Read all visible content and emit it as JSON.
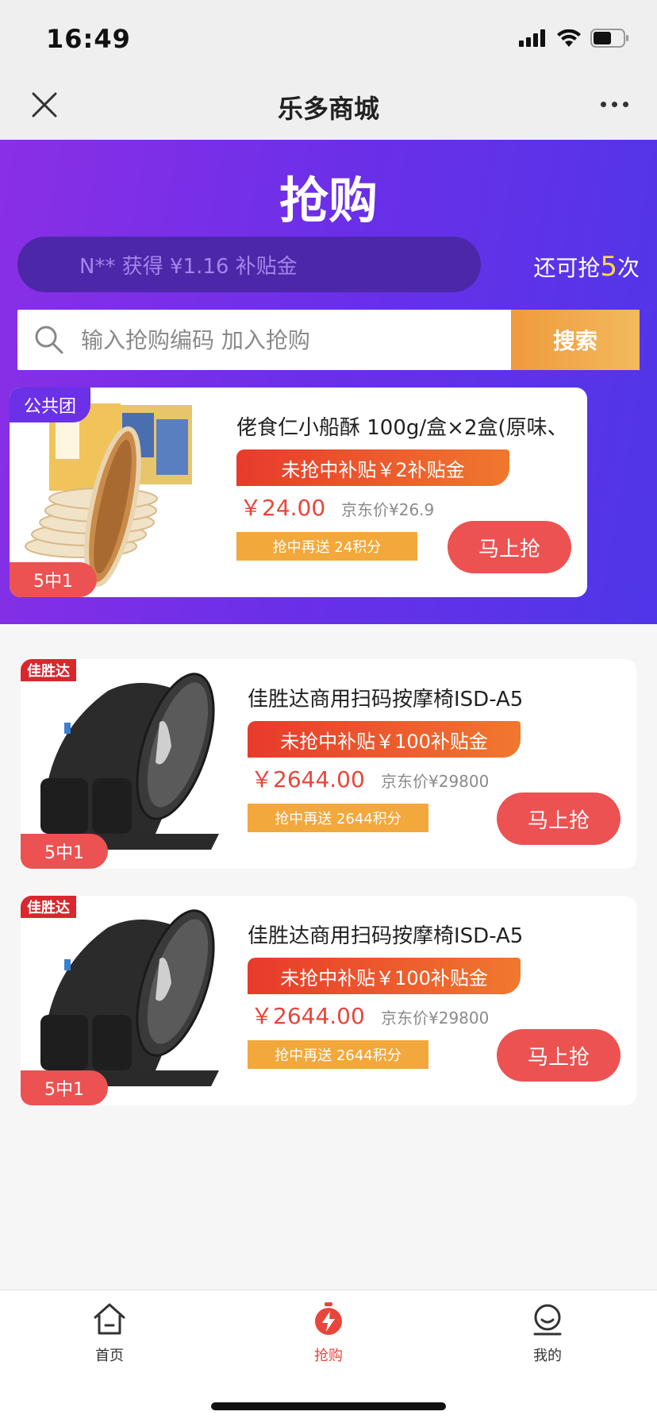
{
  "status": {
    "time": "16:49"
  },
  "nav": {
    "title": "乐多商城"
  },
  "hero": {
    "title": "抢购",
    "ticker": "N** 获得 ¥1.16 补贴金",
    "remain_prefix": "还可抢",
    "remain_count": "5",
    "remain_suffix": "次"
  },
  "search": {
    "placeholder": "输入抢购编码 加入抢购",
    "button": "搜索"
  },
  "products": [
    {
      "badge": "公共团",
      "odds": "5中1",
      "title": "佬食仁小船酥 100g/盒×2盒(原味、",
      "subsidy": "未抢中补贴￥2补贴金",
      "price": "￥24.00",
      "ref_price": "京东价¥26.9",
      "points": "抢中再送 24积分",
      "buy": "马上抢"
    },
    {
      "brand": "佳胜达",
      "odds": "5中1",
      "title": "佳胜达商用扫码按摩椅ISD-A5",
      "subsidy": "未抢中补贴￥100补贴金",
      "price": "￥2644.00",
      "ref_price": "京东价¥29800",
      "points": "抢中再送 2644积分",
      "buy": "马上抢"
    },
    {
      "brand": "佳胜达",
      "odds": "5中1",
      "title": "佳胜达商用扫码按摩椅ISD-A5",
      "subsidy": "未抢中补贴￥100补贴金",
      "price": "￥2644.00",
      "ref_price": "京东价¥29800",
      "points": "抢中再送 2644积分",
      "buy": "马上抢"
    }
  ],
  "tabs": [
    {
      "label": "首页",
      "icon": "home-icon"
    },
    {
      "label": "抢购",
      "icon": "flash-sale-icon"
    },
    {
      "label": "我的",
      "icon": "profile-icon"
    }
  ],
  "colors": {
    "accent_red": "#ec5252",
    "hero_purple": "#6a2fe8",
    "orange": "#f2a83b"
  }
}
